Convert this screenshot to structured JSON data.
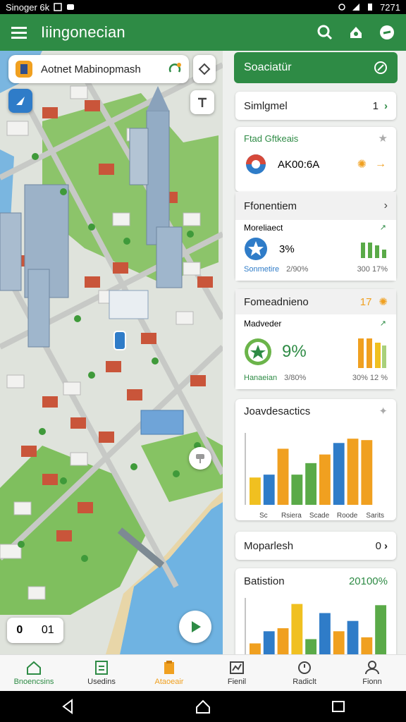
{
  "status": {
    "left_text": "Sinoger 6k",
    "time": "7271"
  },
  "appbar": {
    "title": "Iiingonecian"
  },
  "map": {
    "search_text": "Aotnet Mabinopmash",
    "zoom_left": "0",
    "zoom_right": "01"
  },
  "panel": {
    "header": "Soaciatür",
    "simplified": {
      "label": "Simlgmel",
      "count": "1"
    },
    "card1": {
      "title": "Ftad Gftkeais",
      "code": "AK00:6A"
    },
    "card2": {
      "header": "Ffonentiem",
      "sub": "Moreliaect",
      "value": "3%",
      "foot_left": "Sonmetire",
      "foot_mid": "2/90%",
      "foot_right": "300 17%"
    },
    "card3": {
      "header": "Fomeadnieno",
      "header_value": "17",
      "sub": "Madveder",
      "value": "9%",
      "foot_left": "Hanaeian",
      "foot_mid": "3/80%",
      "foot_right": "30% 12 %"
    },
    "chart1": {
      "title": "Joavdesactics",
      "xlabels": [
        "Sc",
        "Rsiera",
        "Scade",
        "Roode",
        "Sarits"
      ]
    },
    "moparlesh": {
      "label": "Moparlesh",
      "value": "0"
    },
    "chart2": {
      "title": "Batistion",
      "value": "20100%"
    }
  },
  "chart_data": [
    {
      "type": "bar",
      "title": "Joavdesactics",
      "categories": [
        "Sc",
        "",
        "Rsiera",
        "",
        "Scade",
        "",
        "Roode",
        "",
        "Sarits",
        ""
      ],
      "values": [
        38,
        42,
        78,
        42,
        58,
        70,
        86,
        92,
        90,
        0
      ],
      "colors": [
        "#f0c020",
        "#2f7cc8",
        "#f0a020",
        "#5aaa48",
        "#5aaa48",
        "#f0a020",
        "#2f7cc8",
        "#f0a020",
        "#f0a020",
        "#f0a020"
      ],
      "ylim": [
        0,
        100
      ]
    },
    {
      "type": "bar",
      "title": "Batistion",
      "categories": [
        "",
        "",
        "",
        "",
        "",
        "",
        "",
        "",
        "",
        ""
      ],
      "values": [
        25,
        45,
        50,
        90,
        32,
        75,
        45,
        62,
        35,
        88
      ],
      "colors": [
        "#f0a020",
        "#2f7cc8",
        "#f0a020",
        "#f0c020",
        "#5aaa48",
        "#2f7cc8",
        "#f0a020",
        "#2f7cc8",
        "#f0a020",
        "#5aaa48"
      ],
      "ylim": [
        0,
        100
      ]
    }
  ],
  "nav": [
    {
      "label": "Bnoencsins",
      "icon": "home-icon"
    },
    {
      "label": "Usedins",
      "icon": "list-icon"
    },
    {
      "label": "Ataoeair",
      "icon": "clipboard-icon"
    },
    {
      "label": "Fienil",
      "icon": "chart-icon"
    },
    {
      "label": "Radiclt",
      "icon": "clock-icon"
    },
    {
      "label": "Fionn",
      "icon": "person-icon"
    }
  ],
  "colors": {
    "brand_green": "#2e8b45",
    "accent_orange": "#f0a020"
  }
}
